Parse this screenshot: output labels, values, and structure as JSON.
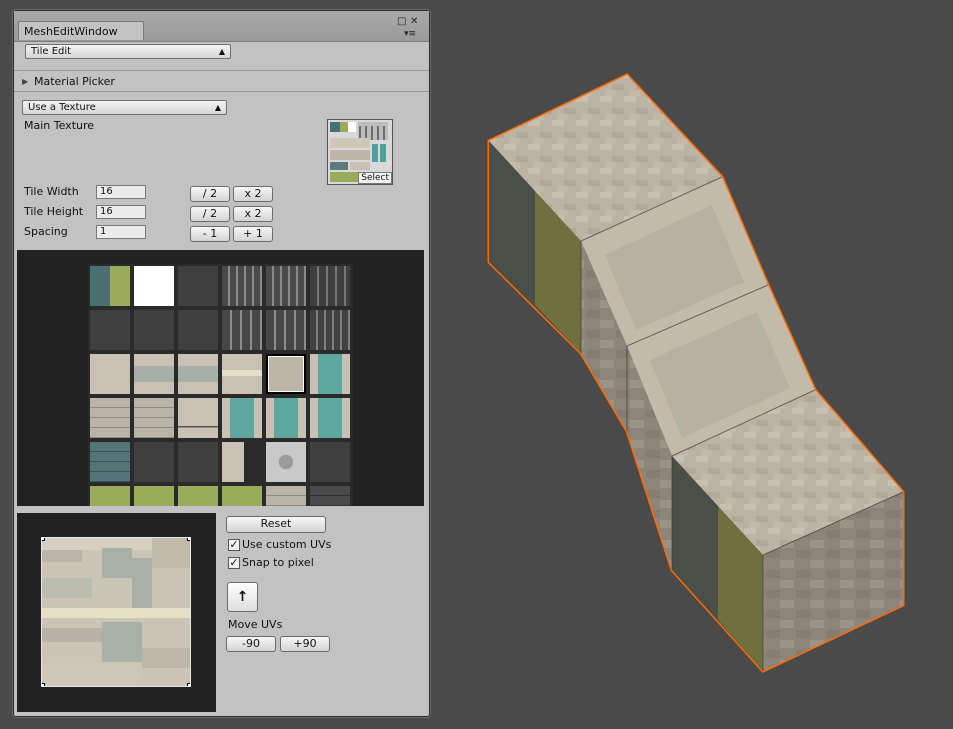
{
  "window": {
    "title": "MeshEditWindow",
    "close_glyph": "✕",
    "menu_glyph": "▾≡",
    "maximize_glyph": "□"
  },
  "mode_dropdown": {
    "value": "Tile Edit"
  },
  "material_picker": {
    "label": "Material Picker",
    "arrow": "▶"
  },
  "texture_source_dropdown": {
    "value": "Use a Texture"
  },
  "main_texture": {
    "label": "Main Texture",
    "select_label": "Select"
  },
  "tile_settings": {
    "tile_width_label": "Tile Width",
    "tile_width_value": "16",
    "tile_height_label": "Tile Height",
    "tile_height_value": "16",
    "spacing_label": "Spacing",
    "spacing_value": "1",
    "halve_label": "/ 2",
    "double_label": "x 2",
    "minus_label": "- 1",
    "plus_label": "+ 1"
  },
  "uv_controls": {
    "reset_label": "Reset",
    "use_custom_uvs_label": "Use custom UVs",
    "use_custom_uvs_checked": true,
    "snap_to_pixel_label": "Snap to pixel",
    "snap_to_pixel_checked": true,
    "move_uvs_label": "Move UVs",
    "rotate_ccw_label": "-90",
    "rotate_cw_label": "+90",
    "move_up_glyph": "↑",
    "check_glyph": "✓"
  },
  "colors": {
    "viewport_bg": "#4a4a4a",
    "panel_bg": "#c2c2c2",
    "selection_outline": "#ff6a00",
    "tile_stone": "#c9c2b4",
    "tile_teal": "#5fa8a0",
    "tile_grass": "#9aac5a",
    "tile_dark": "#3f3f3f"
  },
  "tile_palette_rows": [
    [
      "teal-green",
      "white",
      "dark",
      "fence-top",
      "fence-top",
      "fence-top-dark"
    ],
    [
      "dark",
      "dark",
      "dark",
      "fence-gate",
      "fence-gate",
      "fence-bars"
    ],
    [
      "stone",
      "stone-trim",
      "stone-trim",
      "stone-band",
      "stone-selected",
      "teal-strip"
    ],
    [
      "stone-brick",
      "stone-brick",
      "stone-plain",
      "teal-strip",
      "teal-strip",
      "teal-strip"
    ],
    [
      "teal-brick",
      "dark",
      "dark",
      "stone-half",
      "stone-emblem",
      "dark"
    ],
    [
      "grass",
      "grass",
      "grass",
      "grass",
      "stone-brick",
      "dark-brick"
    ]
  ]
}
